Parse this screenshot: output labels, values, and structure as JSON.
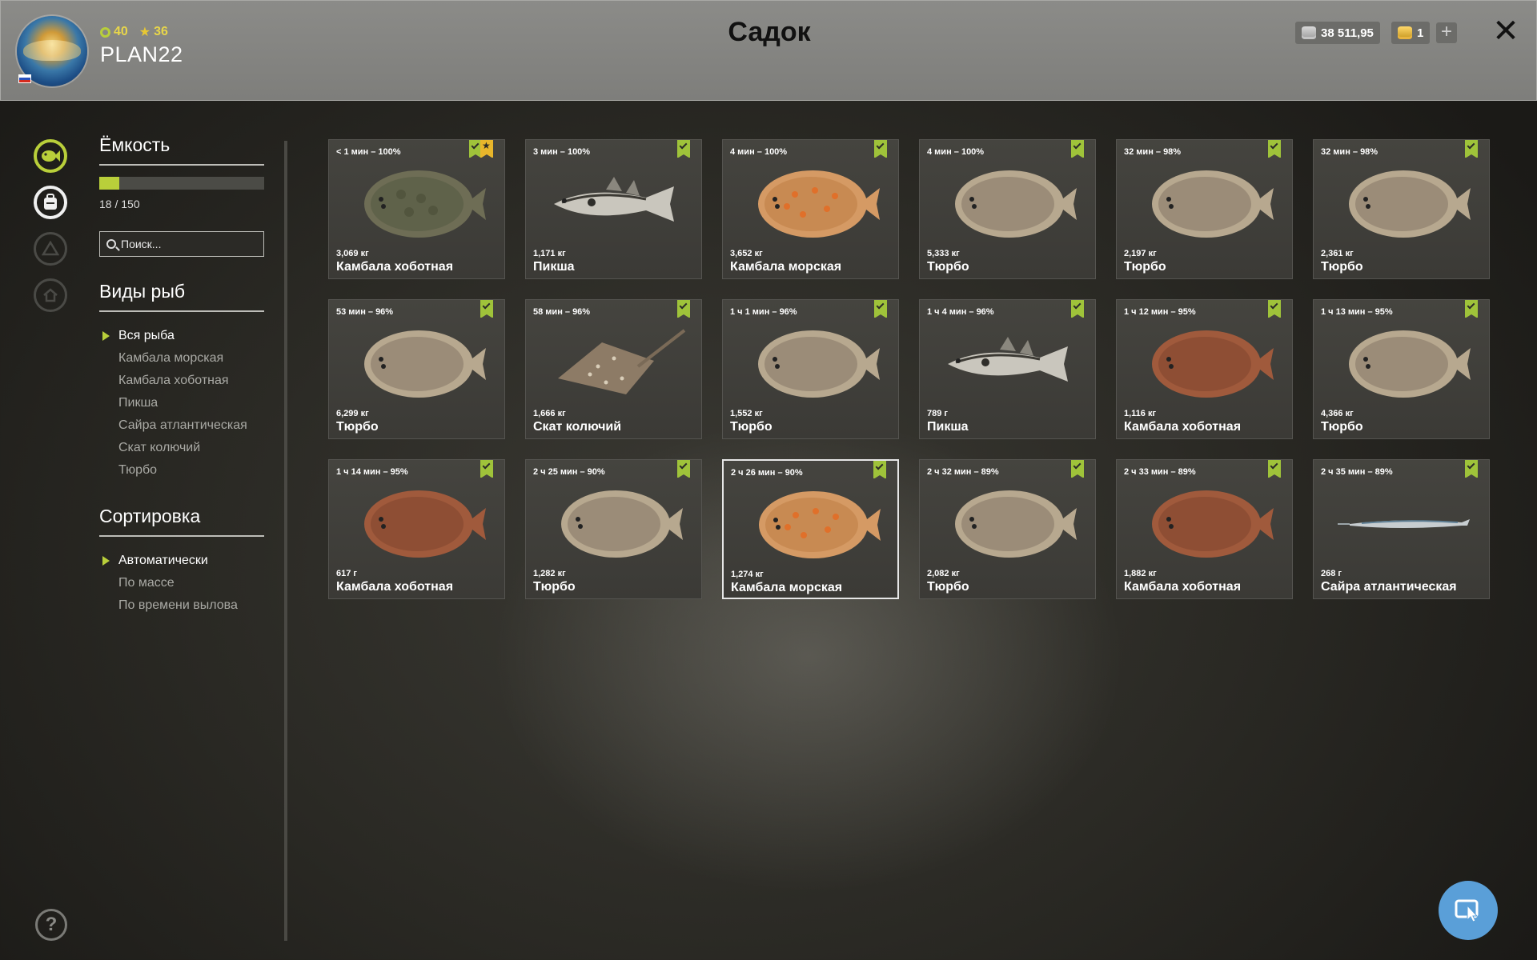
{
  "header": {
    "title": "Садок",
    "username": "PLAN22",
    "level": "40",
    "rank": "36",
    "silver": "38 511,95",
    "gold": "1",
    "plus_label": "+",
    "close_label": "✕"
  },
  "panel": {
    "capacity_title": "Ёмкость",
    "capacity_text": "18 / 150",
    "capacity_fraction": 0.12,
    "search_placeholder": "Поиск...",
    "species_title": "Виды рыб",
    "species": [
      "Вся рыба",
      "Камбала морская",
      "Камбала хоботная",
      "Пикша",
      "Сайра атлантическая",
      "Скат колючий",
      "Тюрбо"
    ],
    "species_selected": 0,
    "sort_title": "Сортировка",
    "sort": [
      "Автоматически",
      "По массе",
      "По времени вылова"
    ],
    "sort_selected": 0
  },
  "help_label": "?",
  "fish": [
    {
      "time": "< 1 мин – 100%",
      "weight": "3,069 кг",
      "name": "Камбала хоботная",
      "kind": "flounder-dark",
      "star": true
    },
    {
      "time": "3 мин – 100%",
      "weight": "1,171 кг",
      "name": "Пикша",
      "kind": "haddock"
    },
    {
      "time": "4 мин – 100%",
      "weight": "3,652 кг",
      "name": "Камбала морская",
      "kind": "plaice"
    },
    {
      "time": "4 мин – 100%",
      "weight": "5,333 кг",
      "name": "Тюрбо",
      "kind": "turbot"
    },
    {
      "time": "32 мин – 98%",
      "weight": "2,197 кг",
      "name": "Тюрбо",
      "kind": "turbot"
    },
    {
      "time": "32 мин – 98%",
      "weight": "2,361 кг",
      "name": "Тюрбо",
      "kind": "turbot"
    },
    {
      "time": "53 мин – 96%",
      "weight": "6,299 кг",
      "name": "Тюрбо",
      "kind": "turbot"
    },
    {
      "time": "58 мин – 96%",
      "weight": "1,666 кг",
      "name": "Скат колючий",
      "kind": "ray"
    },
    {
      "time": "1 ч 1 мин – 96%",
      "weight": "1,552 кг",
      "name": "Тюрбо",
      "kind": "turbot"
    },
    {
      "time": "1 ч 4 мин – 96%",
      "weight": "789 г",
      "name": "Пикша",
      "kind": "haddock",
      "nobadge": true
    },
    {
      "time": "1 ч 12 мин – 95%",
      "weight": "1,116 кг",
      "name": "Камбала хоботная",
      "kind": "flounder-red"
    },
    {
      "time": "1 ч 13 мин – 95%",
      "weight": "4,366 кг",
      "name": "Тюрбо",
      "kind": "turbot"
    },
    {
      "time": "1 ч 14 мин – 95%",
      "weight": "617 г",
      "name": "Камбала хоботная",
      "kind": "flounder-red"
    },
    {
      "time": "2 ч 25 мин – 90%",
      "weight": "1,282 кг",
      "name": "Тюрбо",
      "kind": "turbot",
      "nobadge": true
    },
    {
      "time": "2 ч 26 мин – 90%",
      "weight": "1,274 кг",
      "name": "Камбала морская",
      "kind": "plaice",
      "selected": true
    },
    {
      "time": "2 ч 32 мин – 89%",
      "weight": "2,082 кг",
      "name": "Тюрбо",
      "kind": "turbot"
    },
    {
      "time": "2 ч 33 мин – 89%",
      "weight": "1,882 кг",
      "name": "Камбала хоботная",
      "kind": "flounder-red"
    },
    {
      "time": "2 ч 35 мин – 89%",
      "weight": "268 г",
      "name": "Сайра атлантическая",
      "kind": "saury"
    }
  ],
  "colors": {
    "accent": "#b9cf3a",
    "badge": "#9fc33a",
    "star_badge": "#e8b62b",
    "fab": "#5a9fd8"
  }
}
